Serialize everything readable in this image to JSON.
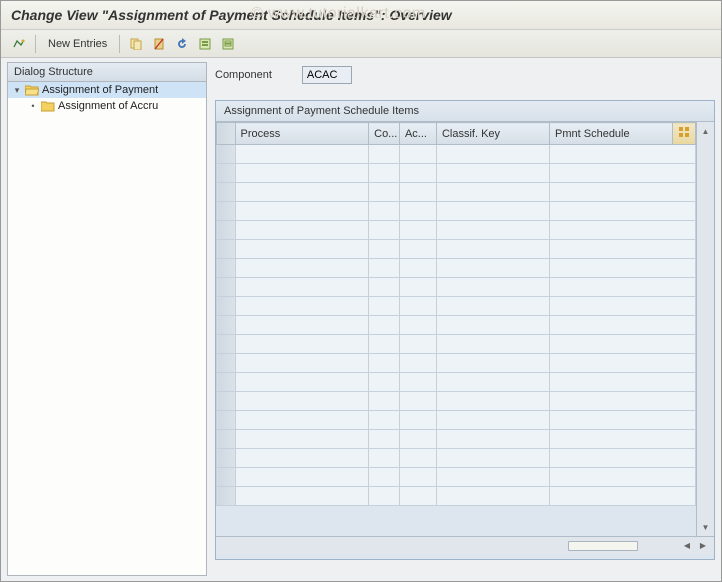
{
  "title": "Change View \"Assignment of Payment Schedule Items\": Overview",
  "watermark": "© www.tutorialkart.com",
  "toolbar": {
    "new_entries": "New Entries"
  },
  "tree": {
    "header": "Dialog Structure",
    "items": [
      {
        "label": "Assignment of Payment",
        "selected": true,
        "open": true,
        "level": 0
      },
      {
        "label": "Assignment of Accru",
        "selected": false,
        "open": false,
        "level": 1
      }
    ]
  },
  "form": {
    "component_label": "Component",
    "component_value": "ACAC"
  },
  "grid": {
    "title": "Assignment of Payment Schedule Items",
    "columns": [
      "Process",
      "Co...",
      "Ac...",
      "Classif. Key",
      "Pmnt Schedule"
    ],
    "row_count": 19,
    "rows": []
  }
}
